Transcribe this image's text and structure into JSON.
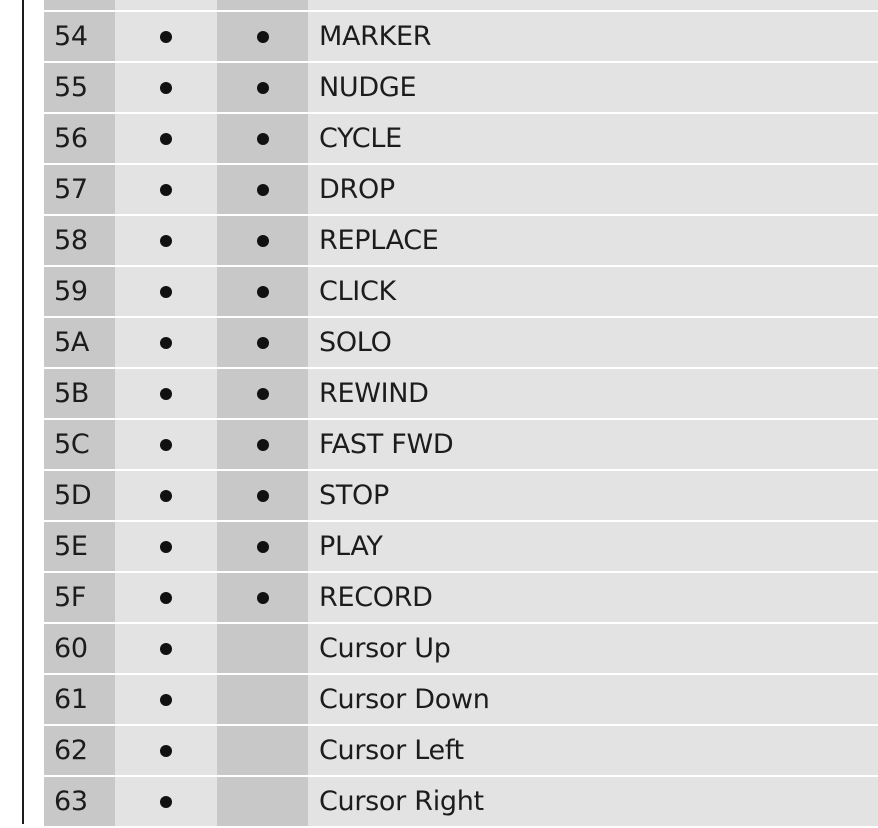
{
  "rows": [
    {
      "hex": "54",
      "col_a": true,
      "col_b": true,
      "function": "MARKER"
    },
    {
      "hex": "55",
      "col_a": true,
      "col_b": true,
      "function": "NUDGE"
    },
    {
      "hex": "56",
      "col_a": true,
      "col_b": true,
      "function": "CYCLE"
    },
    {
      "hex": "57",
      "col_a": true,
      "col_b": true,
      "function": "DROP"
    },
    {
      "hex": "58",
      "col_a": true,
      "col_b": true,
      "function": "REPLACE"
    },
    {
      "hex": "59",
      "col_a": true,
      "col_b": true,
      "function": "CLICK"
    },
    {
      "hex": "5A",
      "col_a": true,
      "col_b": true,
      "function": "SOLO"
    },
    {
      "hex": "5B",
      "col_a": true,
      "col_b": true,
      "function": "REWIND"
    },
    {
      "hex": "5C",
      "col_a": true,
      "col_b": true,
      "function": "FAST FWD"
    },
    {
      "hex": "5D",
      "col_a": true,
      "col_b": true,
      "function": "STOP"
    },
    {
      "hex": "5E",
      "col_a": true,
      "col_b": true,
      "function": "PLAY"
    },
    {
      "hex": "5F",
      "col_a": true,
      "col_b": true,
      "function": "RECORD"
    },
    {
      "hex": "60",
      "col_a": true,
      "col_b": false,
      "function": "Cursor Up"
    },
    {
      "hex": "61",
      "col_a": true,
      "col_b": false,
      "function": "Cursor Down"
    },
    {
      "hex": "62",
      "col_a": true,
      "col_b": false,
      "function": "Cursor Left"
    },
    {
      "hex": "63",
      "col_a": true,
      "col_b": false,
      "function": "Cursor Right"
    }
  ]
}
